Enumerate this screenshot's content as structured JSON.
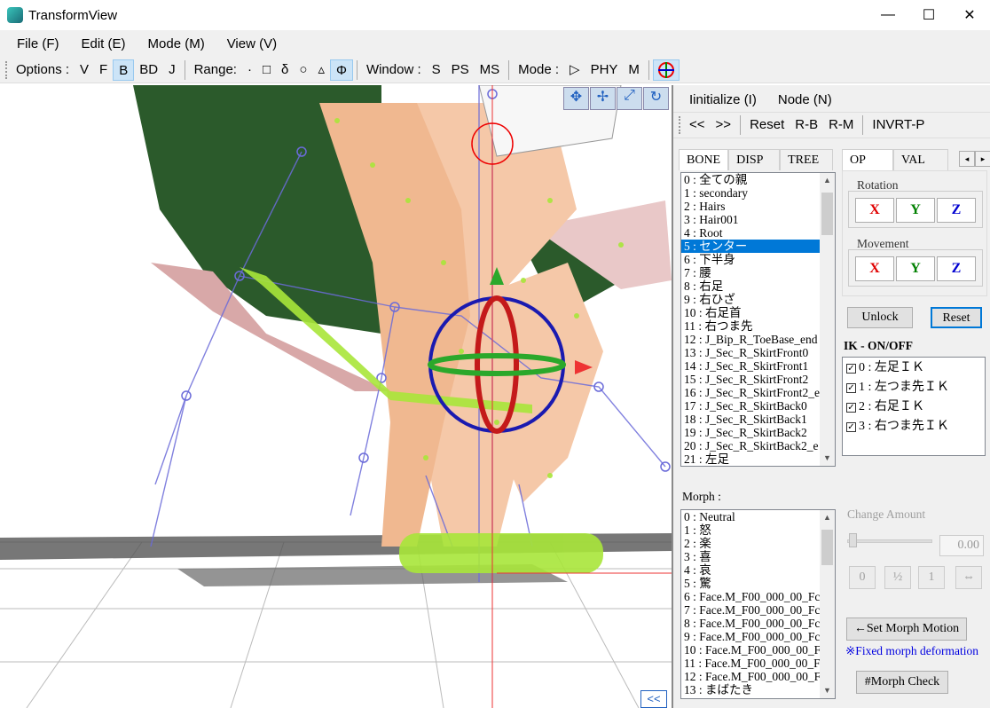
{
  "window": {
    "title": "TransformView",
    "minimize": "—",
    "maximize": "☐",
    "close": "✕"
  },
  "menu": [
    "File (F)",
    "Edit (E)",
    "Mode (M)",
    "View (V)"
  ],
  "toolbar": {
    "options_label": "Options :",
    "options": [
      "V",
      "F",
      "B",
      "BD",
      "J"
    ],
    "range_label": "Range:",
    "range": [
      "·",
      "□",
      "δ",
      "○",
      "▵",
      "Φ"
    ],
    "window_label": "Window :",
    "window": [
      "S",
      "PS",
      "MS"
    ],
    "mode_label": "Mode :",
    "mode": [
      "▷",
      "PHY",
      "M"
    ]
  },
  "panel": {
    "top_menu": [
      "Iinitialize (I)",
      "Node (N)"
    ],
    "nav": [
      "<<",
      ">>",
      "Reset",
      "R-B",
      "R-M",
      "INVRT-P"
    ],
    "bone_tabs": [
      "BONE",
      "DISP",
      "TREE"
    ],
    "bones": [
      "0 : 全ての親",
      "1 : secondary",
      "2 : Hairs",
      "3 : Hair001",
      "4 : Root",
      "5 : センター",
      "6 : 下半身",
      "7 : 腰",
      "8 : 右足",
      "9 : 右ひざ",
      "10 : 右足首",
      "11 : 右つま先",
      "12 : J_Bip_R_ToeBase_end",
      "13 : J_Sec_R_SkirtFront0",
      "14 : J_Sec_R_SkirtFront1",
      "15 : J_Sec_R_SkirtFront2",
      "16 : J_Sec_R_SkirtFront2_e",
      "17 : J_Sec_R_SkirtBack0",
      "18 : J_Sec_R_SkirtBack1",
      "19 : J_Sec_R_SkirtBack2",
      "20 : J_Sec_R_SkirtBack2_e",
      "21 : 左足"
    ],
    "selected_bone": "5 : センター",
    "op_tabs": [
      "OP",
      "VAL"
    ],
    "rotation_label": "Rotation",
    "movement_label": "Movement",
    "axes": [
      "X",
      "Y",
      "Z"
    ],
    "axis_colors": [
      "#e00000",
      "#008000",
      "#0000d0"
    ],
    "unlock": "Unlock",
    "reset": "Reset",
    "ik_label": "IK - ON/OFF",
    "ik_items": [
      "0 : 左足ＩＫ",
      "1 : 左つま先ＩＫ",
      "2 : 右足ＩＫ",
      "3 : 右つま先ＩＫ"
    ],
    "morph_label": "Morph :",
    "morphs": [
      "0 : Neutral",
      "1 : 怒",
      "2 : 楽",
      "3 : 喜",
      "4 : 哀",
      "5 : 驚",
      "6 : Face.M_F00_000_00_Fc",
      "7 : Face.M_F00_000_00_Fc",
      "8 : Face.M_F00_000_00_Fc",
      "9 : Face.M_F00_000_00_Fc",
      "10 : Face.M_F00_000_00_F",
      "11 : Face.M_F00_000_00_F",
      "12 : Face.M_F00_000_00_F",
      "13 : まばたき"
    ],
    "change_amount_label": "Change Amount",
    "change_amount_value": "0.00",
    "amount_buttons": [
      "0",
      "½",
      "1",
      "⇔"
    ],
    "set_morph_motion": "←Set Morph Motion",
    "fixed_note": "※Fixed morph deformation",
    "morph_check": "#Morph Check",
    "collapse": "<<"
  }
}
